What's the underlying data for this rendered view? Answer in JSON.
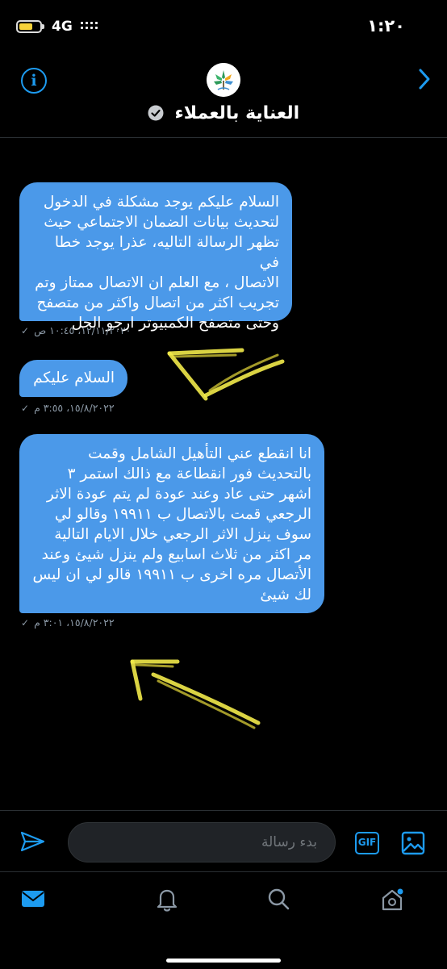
{
  "status_bar": {
    "time": "١:٢٠",
    "network": "4G"
  },
  "header": {
    "contact_name": "العناية بالعملاء"
  },
  "messages": [
    {
      "text": "السلام عليكم يوجد مشكلة في الدخول\nلتحديث بيانات الضمان الاجتماعي حيث\nتظهر الرسالة التاليه، عذرا يوجد خطا في\nالاتصال ، مع العلم ان الاتصال ممتاز وتم\nتجريب اكثر من اتصال واكثر من متصفح\nوحتى متصفح الكمبيوتر ارجو الحل",
      "timestamp": "١٢/١١/٢٠٢٠، ١٠:٤٥ ص"
    },
    {
      "text": "السلام عليكم",
      "timestamp": "١٥/٨/٢٠٢٢، ٣:٥٥ م"
    },
    {
      "text": "انا انقطع عني التأهيل الشامل وقمت\nبالتحديث فور انقطاعة مع ذالك استمر ٣\nاشهر حتى عاد وعند عودة لم يتم عودة الاثر\nالرجعي قمت بالاتصال ب ١٩٩١١ وقالو لي\nسوف ينزل الاثر الرجعي خلال الايام التالية\nمر اكثر من ثلاث اسابيع ولم ينزل شيئ وعند\nالأتصال مره اخرى ب ١٩٩١١ قالو لي ان ليس\nلك شيئ",
      "timestamp": "١٥/٨/٢٠٢٢، ٣:٠١ م"
    }
  ],
  "composer": {
    "placeholder": "بدء رسالة",
    "gif_label": "GIF"
  },
  "colors": {
    "accent": "#1d9bf0",
    "bubble": "#4b99e9",
    "annotation": "#f2ea4a"
  },
  "icons": {
    "info": "info-icon",
    "back": "chevron-right-icon",
    "verified": "verified-badge-icon",
    "send": "send-icon",
    "gif": "gif-icon",
    "image": "image-icon",
    "tabs": [
      "messages-icon",
      "notifications-icon",
      "search-icon",
      "home-icon"
    ]
  }
}
